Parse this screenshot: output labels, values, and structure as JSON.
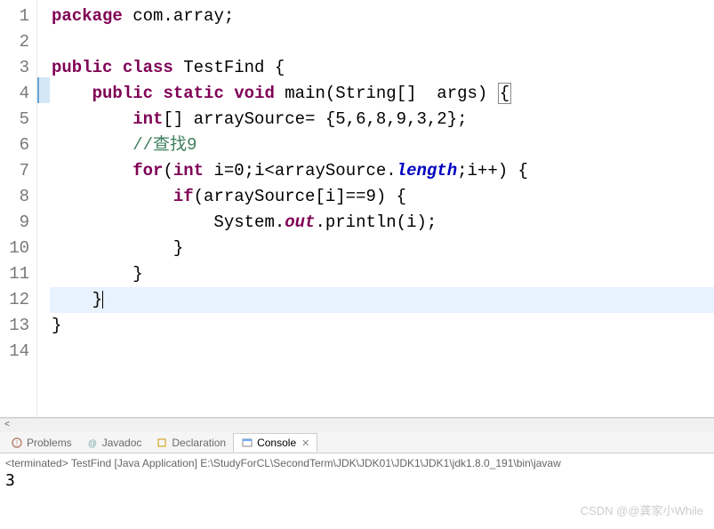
{
  "code": {
    "lines": [
      {
        "n": "1",
        "tokens": [
          [
            "kw",
            "package"
          ],
          [
            "txt",
            " com.array;"
          ]
        ]
      },
      {
        "n": "2",
        "tokens": []
      },
      {
        "n": "3",
        "tokens": [
          [
            "kw",
            "public"
          ],
          [
            "txt",
            " "
          ],
          [
            "kw",
            "class"
          ],
          [
            "txt",
            " TestFind {"
          ]
        ]
      },
      {
        "n": "4",
        "tokens": [
          [
            "txt",
            "    "
          ],
          [
            "kw",
            "public"
          ],
          [
            "txt",
            " "
          ],
          [
            "kw",
            "static"
          ],
          [
            "txt",
            " "
          ],
          [
            "kw",
            "void"
          ],
          [
            "txt",
            " main(String[]  args) "
          ],
          [
            "box",
            "{"
          ]
        ]
      },
      {
        "n": "5",
        "tokens": [
          [
            "txt",
            "        "
          ],
          [
            "kw",
            "int"
          ],
          [
            "txt",
            "[] arraySource= {5,6,8,9,3,2};"
          ]
        ]
      },
      {
        "n": "6",
        "tokens": [
          [
            "txt",
            "        "
          ],
          [
            "comm",
            "//查找9"
          ]
        ]
      },
      {
        "n": "7",
        "tokens": [
          [
            "txt",
            "        "
          ],
          [
            "kw",
            "for"
          ],
          [
            "txt",
            "("
          ],
          [
            "kw",
            "int"
          ],
          [
            "txt",
            " i=0;i<arraySource."
          ],
          [
            "fld",
            "length"
          ],
          [
            "txt",
            ";i++) {"
          ]
        ]
      },
      {
        "n": "8",
        "tokens": [
          [
            "txt",
            "            "
          ],
          [
            "kw",
            "if"
          ],
          [
            "txt",
            "(arraySource[i]==9) {"
          ]
        ]
      },
      {
        "n": "9",
        "tokens": [
          [
            "txt",
            "                System."
          ],
          [
            "st",
            "out"
          ],
          [
            "txt",
            ".println(i);"
          ]
        ]
      },
      {
        "n": "10",
        "tokens": [
          [
            "txt",
            "            }"
          ]
        ]
      },
      {
        "n": "11",
        "tokens": [
          [
            "txt",
            "        }"
          ]
        ]
      },
      {
        "n": "12",
        "tokens": [
          [
            "txt",
            "    }"
          ]
        ],
        "hl": true,
        "cursor": true
      },
      {
        "n": "13",
        "tokens": [
          [
            "txt",
            "}"
          ]
        ]
      },
      {
        "n": "14",
        "tokens": []
      }
    ]
  },
  "tabs": {
    "problems": "Problems",
    "javadoc": "Javadoc",
    "declaration": "Declaration",
    "console": "Console"
  },
  "console": {
    "status": "<terminated> TestFind [Java Application] E:\\StudyForCL\\SecondTerm\\JDK\\JDK01\\JDK1\\JDK1\\jdk1.8.0_191\\bin\\javaw",
    "output": "3"
  },
  "watermark": "CSDN @@龚家小While"
}
